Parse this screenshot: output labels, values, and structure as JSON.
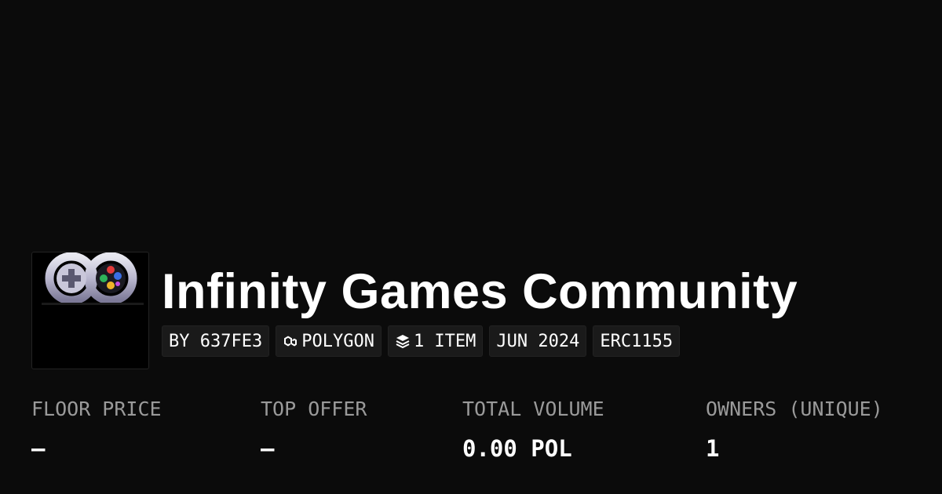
{
  "collection": {
    "title": "Infinity Games Community",
    "logo_icon": "infinity-gamepad-logo"
  },
  "chips": {
    "creator": "BY 637FE3",
    "chain": "POLYGON",
    "chain_icon": "polygon-icon",
    "items": "1 ITEM",
    "items_icon": "layers-icon",
    "date": "JUN 2024",
    "standard": "ERC1155"
  },
  "stats": {
    "floor_price": {
      "label": "FLOOR PRICE",
      "value": "–"
    },
    "top_offer": {
      "label": "TOP OFFER",
      "value": "–"
    },
    "total_volume": {
      "label": "TOTAL VOLUME",
      "value": "0.00 POL"
    },
    "owners": {
      "label": "OWNERS (UNIQUE)",
      "value": "1"
    }
  },
  "colors": {
    "background": "#0b0b0b",
    "chip_background": "#1a1a1a",
    "label_gray": "#9a9a9a",
    "text": "#ffffff"
  }
}
